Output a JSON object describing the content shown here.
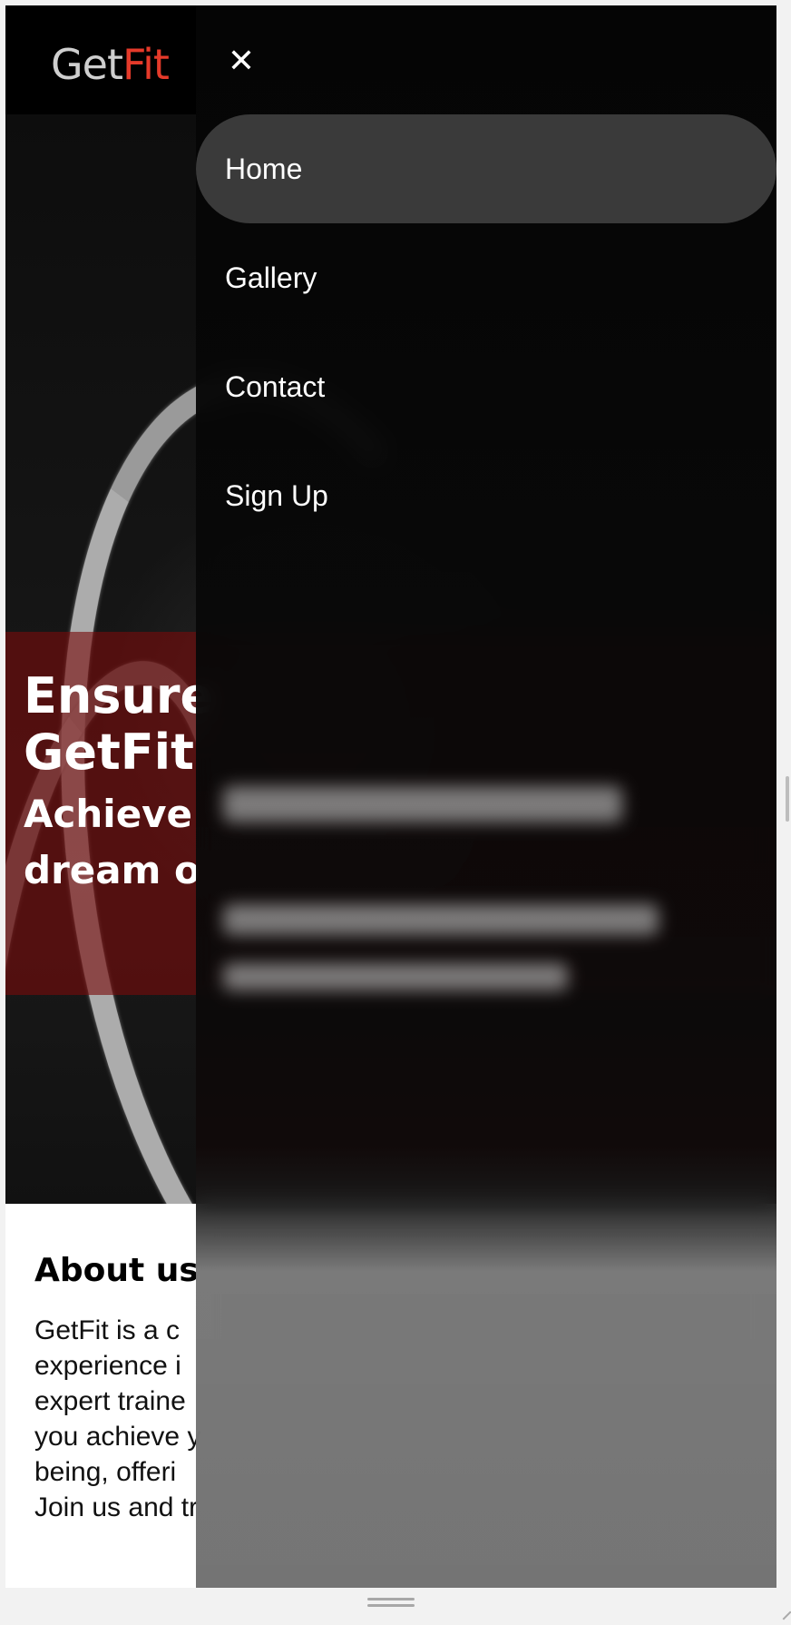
{
  "brand": {
    "get": "Get",
    "fit": "Fit"
  },
  "hero": {
    "title_line1": "Ensure",
    "title_line2": "GetFit",
    "subtitle_line1": "Achieve",
    "subtitle_line2": "dream o"
  },
  "about": {
    "title": "About us",
    "lines": [
      "GetFit is a c",
      "experience i",
      "expert traine",
      "you achieve y",
      "being, offeri",
      "Join us and tr"
    ]
  },
  "drawer": {
    "close_icon": "close-icon",
    "items": [
      {
        "label": "Home",
        "active": true
      },
      {
        "label": "Gallery",
        "active": false
      },
      {
        "label": "Contact",
        "active": false
      },
      {
        "label": "Sign Up",
        "active": false
      }
    ]
  },
  "colors": {
    "accent": "#e53a2a",
    "hero_overlay": "#780c0c",
    "drawer_active": "#3a3a3a"
  }
}
